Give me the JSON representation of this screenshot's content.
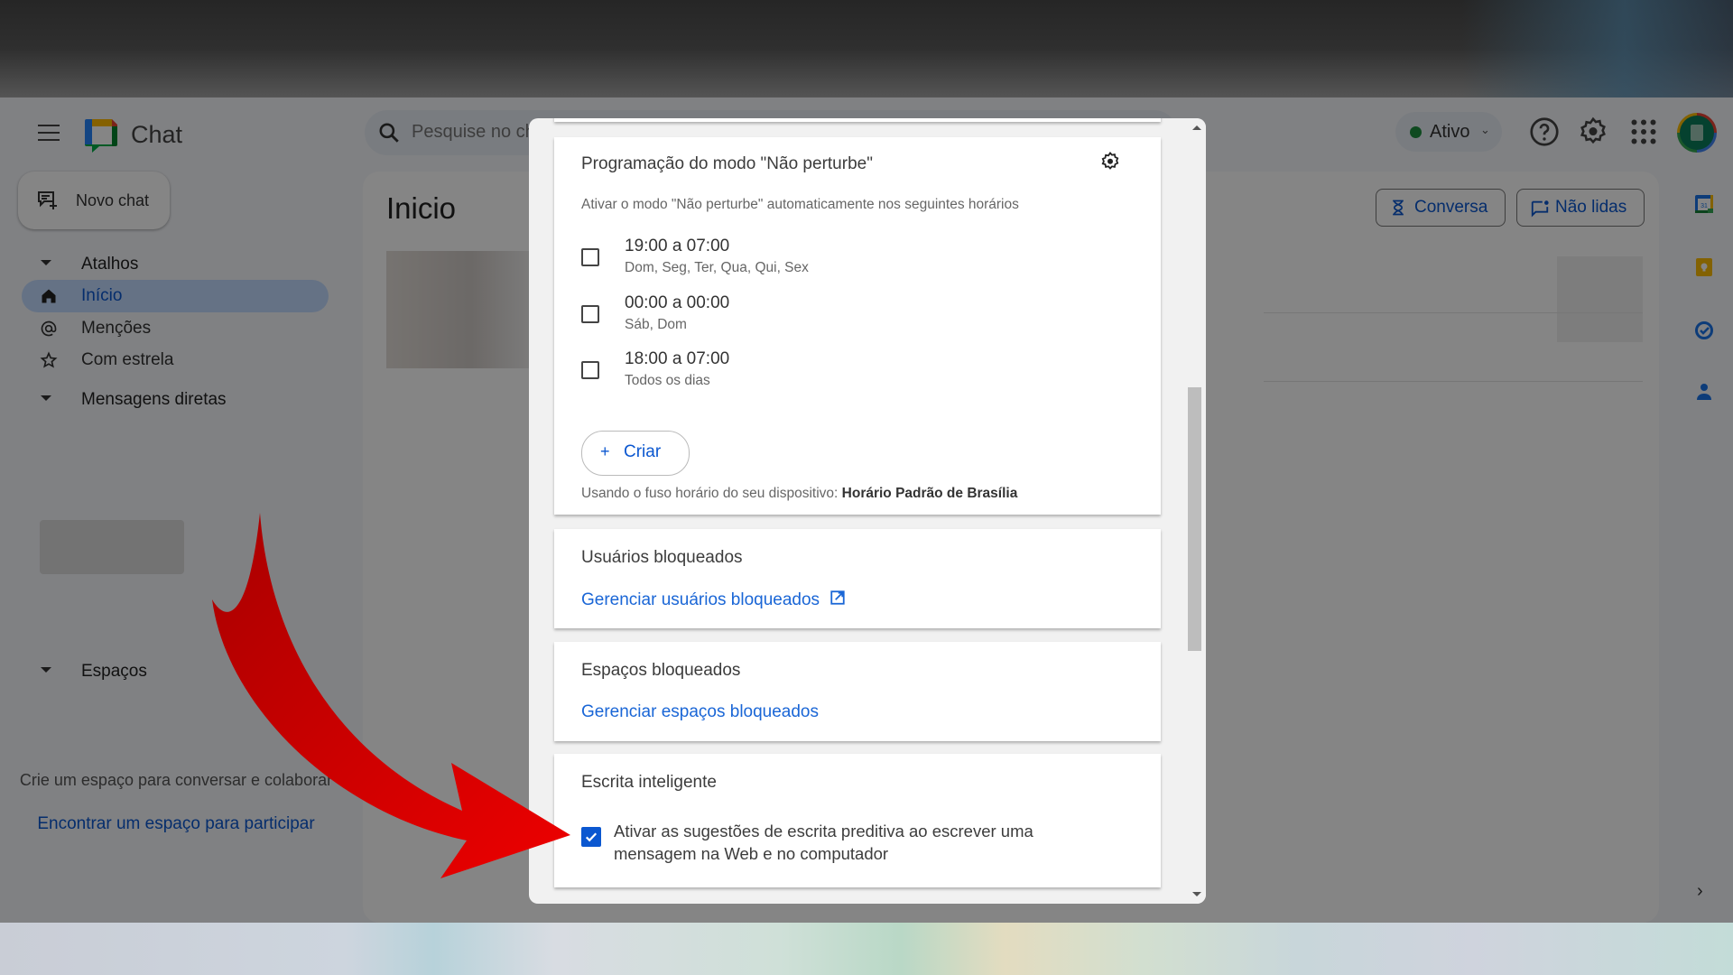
{
  "app": {
    "name": "Chat",
    "search_placeholder": "Pesquise no chat",
    "status_label": "Ativo",
    "status_color": "#1e8e3e"
  },
  "header_icons": [
    "menu-icon",
    "help-icon",
    "settings-icon",
    "apps-grid-icon",
    "avatar"
  ],
  "sidebar": {
    "new_chat_label": "Novo chat",
    "sections": {
      "shortcuts": "Atalhos",
      "direct_messages": "Mensagens diretas",
      "spaces": "Espaços"
    },
    "items": [
      {
        "label": "Início",
        "icon": "home-icon",
        "active": true
      },
      {
        "label": "Menções",
        "icon": "at-icon",
        "active": false
      },
      {
        "label": "Com estrela",
        "icon": "star-icon",
        "active": false
      }
    ],
    "spaces_empty_text": "Crie um espaço para conversar e colaborar",
    "spaces_link": "Encontrar um espaço para participar"
  },
  "main": {
    "title": "Inicio",
    "filters": [
      {
        "label": "Conversa",
        "icon": "hourglass-filter-icon"
      },
      {
        "label": "Não lidas",
        "icon": "unread-chat-icon"
      }
    ]
  },
  "right_rail": [
    "calendar-icon",
    "keep-icon",
    "tasks-icon",
    "contacts-icon"
  ],
  "settings_modal": {
    "dnd": {
      "title": "Programação do modo \"Não perturbe\"",
      "description": "Ativar o modo \"Não perturbe\" automaticamente nos seguintes horários",
      "schedules": [
        {
          "time": "19:00 a 07:00",
          "days": "Dom, Seg, Ter, Qua, Qui, Sex",
          "checked": false
        },
        {
          "time": "00:00 a 00:00",
          "days": "Sáb, Dom",
          "checked": false
        },
        {
          "time": "18:00 a 07:00",
          "days": "Todos os dias",
          "checked": false
        }
      ],
      "create_label": "Criar",
      "timezone_prefix": "Usando o fuso horário do seu dispositivo:",
      "timezone_name": "Horário Padrão de Brasília"
    },
    "blocked_users": {
      "title": "Usuários bloqueados",
      "link": "Gerenciar usuários bloqueados"
    },
    "blocked_spaces": {
      "title": "Espaços bloqueados",
      "link": "Gerenciar espaços bloqueados"
    },
    "smart_compose": {
      "title": "Escrita inteligente",
      "option": "Ativar as sugestões de escrita preditiva ao escrever uma mensagem na Web e no computador",
      "checked": true
    },
    "accent_color": "#0b57d0"
  },
  "annotation": {
    "arrow_color": "#e00000",
    "points_to": "smart-compose-checkbox"
  }
}
